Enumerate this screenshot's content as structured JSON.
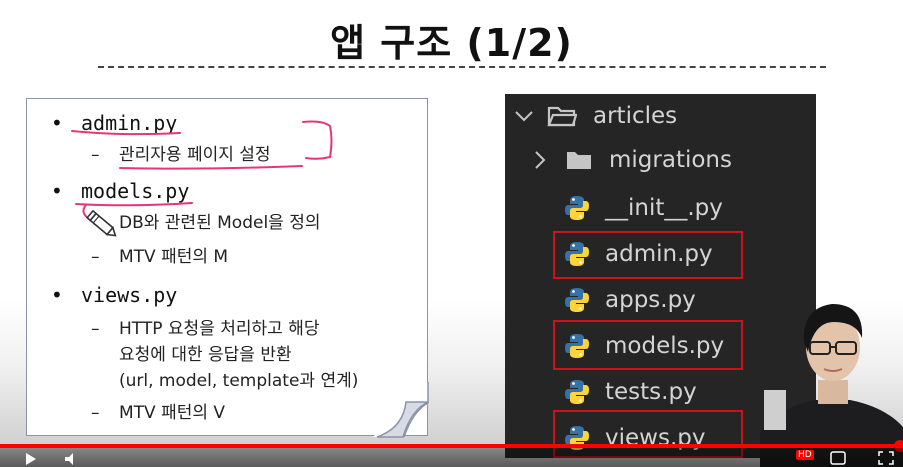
{
  "slide": {
    "title": "앱 구조 (1/2)"
  },
  "note": {
    "items": [
      {
        "name": "admin.py",
        "details": [
          "관리자용 페이지 설정"
        ]
      },
      {
        "name": "models.py",
        "details": [
          "DB와 관련된 Model을 정의",
          "MTV 패턴의 M"
        ]
      },
      {
        "name": "views.py",
        "details": [
          "HTTP 요청을 처리하고 해당",
          "요청에 대한 응답을 반환",
          "(url, model, template과 연계)",
          "MTV 패턴의 V"
        ]
      }
    ],
    "bullet_glyph": "•",
    "dash_glyph": "–"
  },
  "explorer": {
    "folder": "articles",
    "subfolder": "migrations",
    "files": [
      "__init__.py",
      "admin.py",
      "apps.py",
      "models.py",
      "tests.py",
      "views.py"
    ],
    "highlighted": [
      "admin.py",
      "models.py",
      "views.py"
    ],
    "colors": {
      "background": "#252526",
      "text": "#d4d4d4",
      "highlight": "#d0101a",
      "python_blue": "#3572a5",
      "python_yellow": "#ffd43b"
    }
  },
  "player": {
    "hd_badge": "HD",
    "progress": 0.99,
    "progress_color": "#ff0000"
  }
}
